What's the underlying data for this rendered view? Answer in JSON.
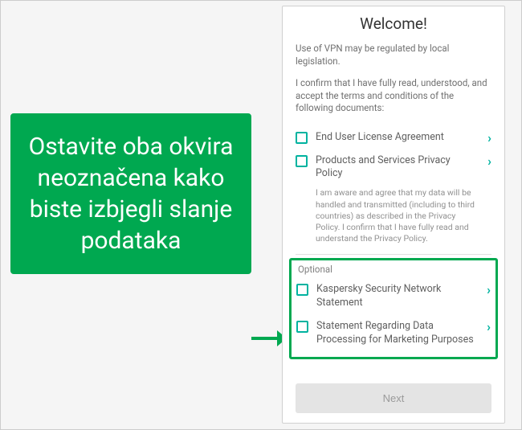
{
  "callout": {
    "text": "Ostavite oba okvira neoznačena kako biste izbjegli slanje podataka"
  },
  "screen": {
    "title": "Welcome!",
    "intro1": "Use of VPN may be regulated by local legislation.",
    "intro2": "I confirm that I have fully read, understood, and accept the terms and conditions of the following documents:",
    "docs": {
      "eula": "End User License Agreement",
      "privacy": "Products and Services Privacy Policy",
      "privacy_note": "I am aware and agree that my data will be handled and transmitted (including to third countries) as described in the Privacy Policy. I confirm that I have fully read and understand the Privacy Policy."
    },
    "optional_label": "Optional",
    "optional": {
      "ksn": "Kaspersky Security Network Statement",
      "marketing": "Statement Regarding Data Processing for Marketing Purposes"
    },
    "next": "Next"
  },
  "colors": {
    "accent_green": "#00a850",
    "checkbox_teal": "#00b3a0"
  }
}
